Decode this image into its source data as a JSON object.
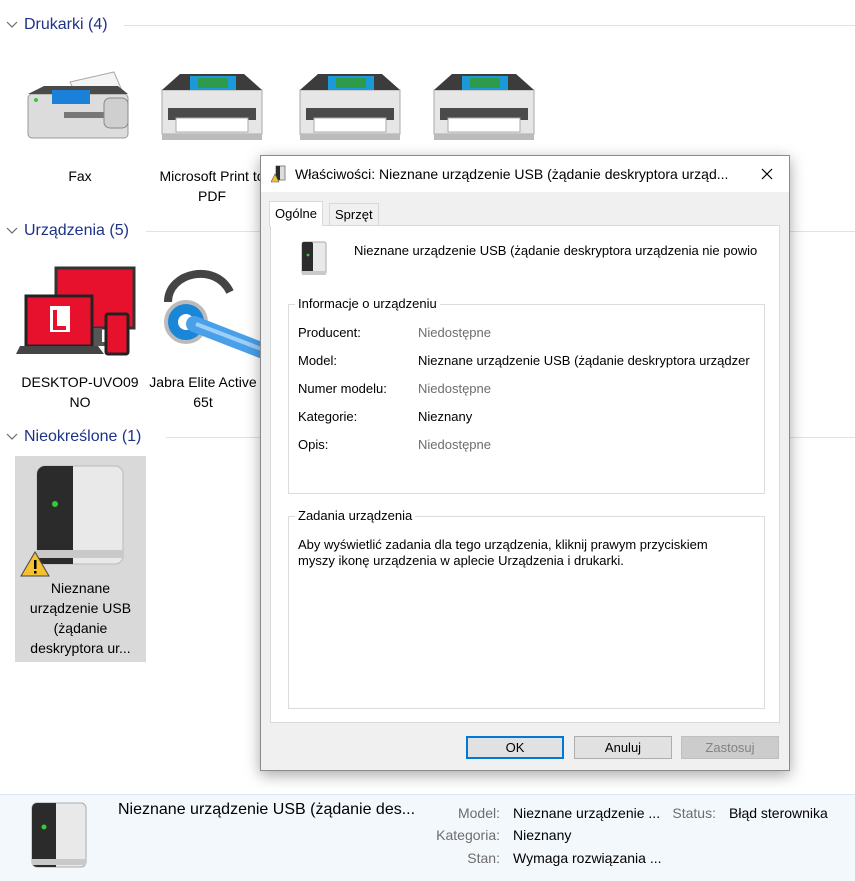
{
  "groups": {
    "printers": "Drukarki (4)",
    "devices": "Urządzenia (5)",
    "unspecified": "Nieokreślone (1)"
  },
  "printers": [
    {
      "label": "Fax"
    },
    {
      "label": "Microsoft Print to PDF"
    },
    {
      "label": ""
    },
    {
      "label": ""
    }
  ],
  "devices": [
    {
      "label": "DESKTOP-UVO09 NO"
    },
    {
      "label": "Jabra Elite Active 65t"
    }
  ],
  "unspecified": [
    {
      "label": "Nieznane urządzenie USB (żądanie deskryptora ur..."
    }
  ],
  "dialog": {
    "title": "Właściwości: Nieznane urządzenie USB (żądanie deskryptora urząd...",
    "tabs": [
      "Ogólne",
      "Sprzęt"
    ],
    "device_name": "Nieznane urządzenie USB (żądanie deskryptora urządzenia nie powio",
    "info_legend": "Informacje o urządzeniu",
    "info": [
      {
        "key": "Producent:",
        "value": "Niedostępne"
      },
      {
        "key": "Model:",
        "value": "Nieznane urządzenie USB (żądanie deskryptora urządzer"
      },
      {
        "key": "Numer modelu:",
        "value": "Niedostępne"
      },
      {
        "key": "Kategorie:",
        "value": "Nieznany"
      },
      {
        "key": "Opis:",
        "value": "Niedostępne"
      }
    ],
    "tasks_legend": "Zadania urządzenia",
    "tasks_text_1": "Aby wyświetlić zadania dla tego urządzenia, kliknij prawym przyciskiem",
    "tasks_text_2": "myszy ikonę urządzenia w aplecie Urządzenia i drukarki.",
    "ok": "OK",
    "cancel": "Anuluj",
    "apply": "Zastosuj"
  },
  "details": {
    "name": "Nieznane urządzenie USB (żądanie des...",
    "model_key": "Model:",
    "model_value": "Nieznane urządzenie ...",
    "status_key": "Status:",
    "status_value": "Błąd sterownika",
    "category_key": "Kategoria:",
    "category_value": "Nieznany",
    "state_key": "Stan:",
    "state_value": "Wymaga rozwiązania ..."
  },
  "colors": {
    "group_header": "#1e3287",
    "accent": "#0078d7",
    "warning": "#f5c12e",
    "laptop_red": "#e8112d"
  }
}
